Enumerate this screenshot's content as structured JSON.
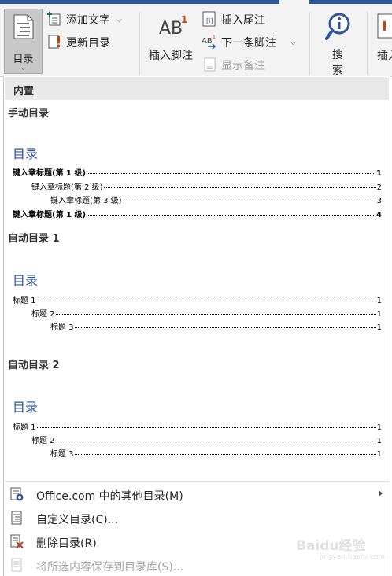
{
  "ribbon": {
    "toc_label": "目录",
    "add_text": "添加文字",
    "update_toc": "更新目录",
    "insert_footnote": "插入脚注",
    "insert_endnote": "插入尾注",
    "next_footnote": "下一条脚注",
    "show_notes": "显示备注",
    "search_line1": "搜",
    "search_line2": "索",
    "insert_partial": "插入"
  },
  "gallery": {
    "header": "内置",
    "manual": {
      "title": "手动目录",
      "heading": "目录",
      "entries": [
        {
          "text": "键入章标题(第 1 级)",
          "page": "1"
        },
        {
          "text": "键入章标题(第 2 级)",
          "page": "2"
        },
        {
          "text": "键入章标题(第 3 级)",
          "page": "3"
        },
        {
          "text": "键入章标题(第 1 级)",
          "page": "4"
        }
      ]
    },
    "auto1": {
      "title": "自动目录 1",
      "heading": "目录",
      "entries": [
        {
          "text": "标题 1",
          "page": "1"
        },
        {
          "text": "标题 2",
          "page": "1"
        },
        {
          "text": "标题 3",
          "page": "1"
        }
      ]
    },
    "auto2": {
      "title": "自动目录 2",
      "heading": "目录",
      "entries": [
        {
          "text": "标题 1",
          "page": "1"
        },
        {
          "text": "标题 2",
          "page": "1"
        },
        {
          "text": "标题 3",
          "page": "1"
        }
      ]
    }
  },
  "menu": [
    {
      "label": "Office.com 中的其他目录(M)",
      "icon": "office-toc-icon",
      "submenu": true,
      "disabled": false
    },
    {
      "label": "自定义目录(C)...",
      "icon": "custom-toc-icon",
      "submenu": false,
      "disabled": false
    },
    {
      "label": "删除目录(R)",
      "icon": "remove-toc-icon",
      "submenu": false,
      "disabled": false
    },
    {
      "label": "将所选内容保存到目录库(S)...",
      "icon": "save-selection-icon",
      "submenu": false,
      "disabled": true
    }
  ],
  "watermark": {
    "text": "Baidu经验",
    "sub": "jingyan.baidu.com"
  },
  "colors": {
    "accent": "#2b579a",
    "toc_heading": "#2f5496",
    "disabled": "#a6a6a6",
    "delete_red": "#c0392b"
  }
}
